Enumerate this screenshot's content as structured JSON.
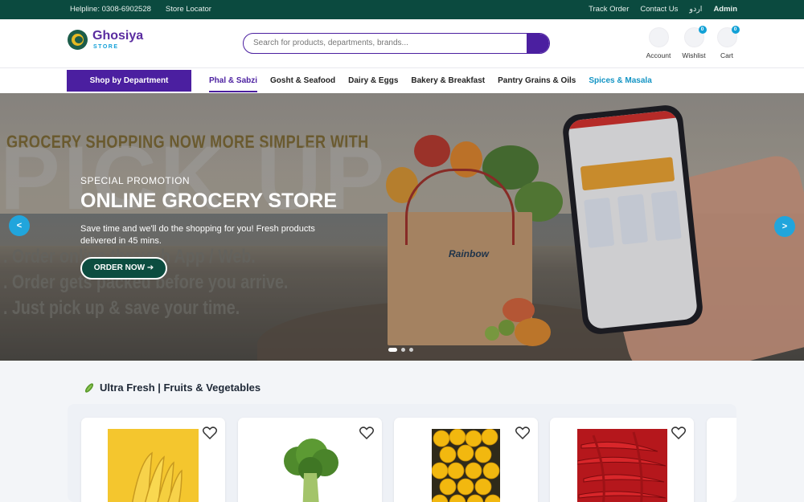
{
  "topbar": {
    "helpline": "Helpline: 0308-6902528",
    "store_locator": "Store Locator",
    "track_order": "Track Order",
    "contact_us": "Contact Us",
    "language": "اردو",
    "admin": "Admin"
  },
  "header": {
    "logo_name": "Ghosiya",
    "logo_sub": "STORE",
    "search_placeholder": "Search for products, departments, brands...",
    "account_label": "Account",
    "wishlist_label": "Wishlist",
    "wishlist_count": "0",
    "cart_label": "Cart",
    "cart_count": "0"
  },
  "nav": {
    "shop_by_department": "Shop by Department",
    "links": [
      "Phal & Sabzi",
      "Gosht & Seafood",
      "Dairy & Eggs",
      "Bakery & Breakfast",
      "Pantry Grains & Oils",
      "Spices & Masala"
    ],
    "active_index": 0
  },
  "hero": {
    "bg_heading": "GROCERY SHOPPING NOW MORE SIMPLER WITH",
    "bg_big": "PICK UP",
    "bg_line_1": ". Order online through App / Web.",
    "bg_line_2": ". Order gets packed before you arrive.",
    "bg_line_3": ". Just pick up & save your time.",
    "promo_subtitle": "SPECIAL PROMOTION",
    "promo_title": "ONLINE GROCERY STORE",
    "promo_description": "Save time and we'll do the shopping for you! Fresh products delivered in 45 mins.",
    "cta_label": "ORDER NOW ➔",
    "bag_brand": "Rainbow",
    "prev_label": "<",
    "next_label": ">",
    "slide_count": 3,
    "active_slide": 0
  },
  "section": {
    "title": "Ultra Fresh | Fruits & Vegetables",
    "icon": "cucumber-icon"
  },
  "products": [
    {
      "name": "Bananas",
      "icon": "heart-icon"
    },
    {
      "name": "Broccoli",
      "icon": "heart-icon"
    },
    {
      "name": "Lemons",
      "icon": "heart-icon"
    },
    {
      "name": "Red Chilli",
      "icon": "heart-icon"
    }
  ],
  "colors": {
    "topbar": "#0b4a3f",
    "brand_purple": "#4b1fa0",
    "accent_blue": "#21a5dc",
    "cta_green": "#0c4d40"
  }
}
